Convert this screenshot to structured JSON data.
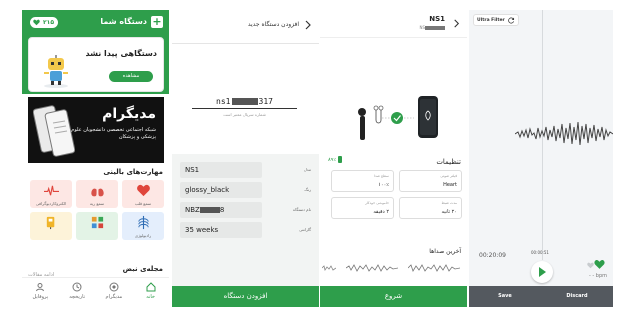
{
  "colors": {
    "primary": "#2e9e4b",
    "dark_bar": "#54595f"
  },
  "home": {
    "header_title": "دستگاه شما",
    "add_icon": "plus-icon",
    "credit": "۲۱۵",
    "no_device_text": "دستگاهی پیدا نشد",
    "view_button": "مشاهده",
    "banner_title": "مدیگرام",
    "banner_subtitle": "شبکه اجتماعی تخصصی دانشجویان علوم پزشکی و پزشکان",
    "skills_title": "مهارت‌های بالینی",
    "skills": [
      {
        "label": "سمع قلب",
        "icon": "heart-icon"
      },
      {
        "label": "سمع ریه",
        "icon": "lungs-icon"
      },
      {
        "label": "الکتروکاردیوگرافی",
        "icon": "ecg-icon"
      },
      {
        "label": "رادیولوژی",
        "icon": "ribcage-icon"
      },
      {
        "label": "",
        "icon": "grid-icon"
      },
      {
        "label": "",
        "icon": "tools-icon"
      }
    ],
    "magazine_title": "مجله‌ی نبض",
    "magazine_more": "ادامه مقالات",
    "nav": [
      {
        "label": "خانه",
        "icon": "home-icon"
      },
      {
        "label": "مدیگرام",
        "icon": "medigram-icon"
      },
      {
        "label": "تاریخچه",
        "icon": "history-icon"
      },
      {
        "label": "پروفایل",
        "icon": "profile-icon"
      }
    ]
  },
  "add_device": {
    "title": "افزودن دستگاه جدید",
    "serial_prefix": "ns1",
    "serial_suffix": "317",
    "serial_hint": "شماره سریال معتبر است",
    "rows": [
      {
        "key": "مدل",
        "value": "NS1"
      },
      {
        "key": "رنگ",
        "value": "glossy_black"
      },
      {
        "key": "نام دستگاه",
        "value": "NBZ",
        "value_suffix": "8"
      },
      {
        "key": "گارانتی",
        "value": "35 weeks"
      }
    ],
    "button": "افزودن دستگاه"
  },
  "device": {
    "title": "NS1",
    "subtitle_prefix": "NS",
    "settings_title": "تنظیمات",
    "battery": "۸۹٪",
    "cards": [
      {
        "key": "فیلتر صوتی",
        "value": "Heart"
      },
      {
        "key": "سطح صدا",
        "value": "۱۰۰٪"
      },
      {
        "key": "مدت ضبط",
        "value": "۲۰ ثانیه"
      },
      {
        "key": "خاموشی خودکار",
        "value": "۲ دقیقه"
      }
    ],
    "recent_title": "آخرین صداها",
    "button": "شروع"
  },
  "recording": {
    "filter_label": "Ultra Filter",
    "filter_icon": "refresh-icon",
    "mid_time": "00:00:51",
    "time": "00:20:09",
    "bpm": "- - bpm",
    "save": "Save",
    "discard": "Discard"
  }
}
